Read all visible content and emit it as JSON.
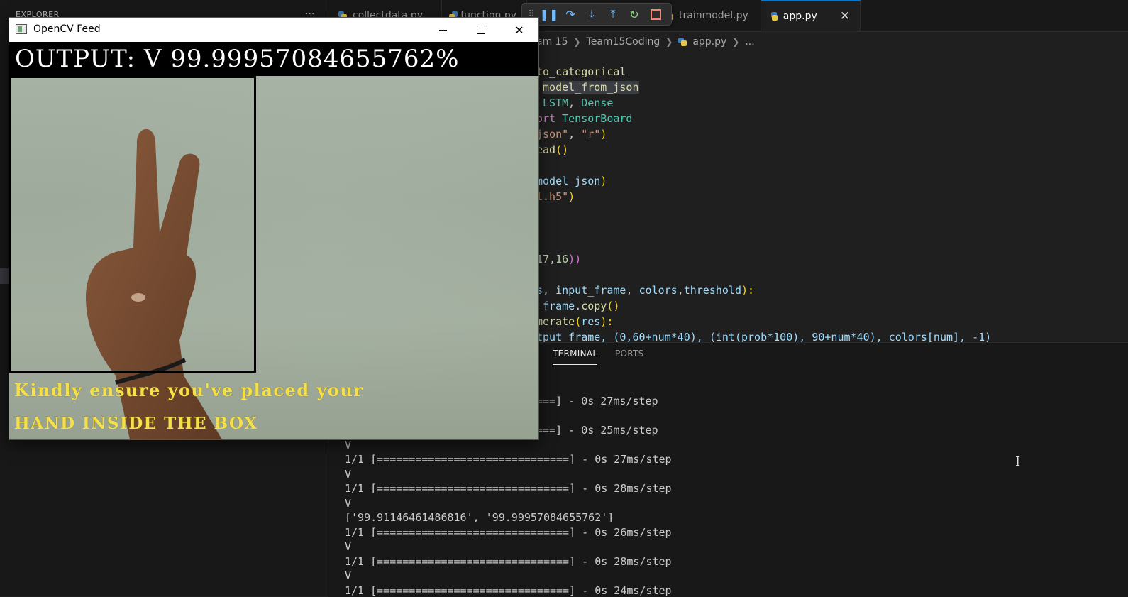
{
  "sidebar": {
    "title": "EXPLORER",
    "more_label": "···"
  },
  "tabs": [
    {
      "label": "collectdata.py",
      "active": false
    },
    {
      "label": "function.py",
      "active": false
    },
    {
      "label": "trainmodel.py",
      "active": false
    },
    {
      "label": "app.py",
      "active": true,
      "close": "✕"
    }
  ],
  "debug_toolbar": [
    "drag-handle",
    "pause",
    "step-over",
    "step-into",
    "step-out",
    "restart",
    "stop"
  ],
  "breadcrumb": {
    "items": [
      "am 15",
      "Team15Coding",
      "app.py",
      "..."
    ]
  },
  "editor": {
    "lines": [
      [
        {
          "t": "to_categorical",
          "c": "fn"
        }
      ],
      [
        {
          "t": " ",
          "c": "plain"
        },
        {
          "t": "model_from_json",
          "c": "fn",
          "hl": true
        }
      ],
      [
        {
          "t": " ",
          "c": "plain"
        },
        {
          "t": "LSTM",
          "c": "cls"
        },
        {
          "t": ", ",
          "c": "plain"
        },
        {
          "t": "Dense",
          "c": "cls"
        }
      ],
      [
        {
          "t": "ort ",
          "c": "kw"
        },
        {
          "t": "TensorBoard",
          "c": "cls"
        }
      ],
      [
        {
          "t": "json\"",
          "c": "str"
        },
        {
          "t": ", ",
          "c": "plain"
        },
        {
          "t": "\"r\"",
          "c": "str"
        },
        {
          "t": ")",
          "c": "br1"
        }
      ],
      [
        {
          "t": "ead",
          "c": "fn"
        },
        {
          "t": "()",
          "c": "br1"
        }
      ],
      [],
      [
        {
          "t": "model_json",
          "c": "var"
        },
        {
          "t": ")",
          "c": "br1"
        }
      ],
      [
        {
          "t": "l.h5\"",
          "c": "str"
        },
        {
          "t": ")",
          "c": "br1"
        }
      ],
      [],
      [],
      [],
      [
        {
          "t": "17",
          "c": "num"
        },
        {
          "t": ",",
          "c": "plain"
        },
        {
          "t": "16",
          "c": "num"
        },
        {
          "t": "))",
          "c": "br2"
        }
      ],
      [],
      [
        {
          "t": "s",
          "c": "var"
        },
        {
          "t": ", ",
          "c": "plain"
        },
        {
          "t": "input_frame",
          "c": "var"
        },
        {
          "t": ", ",
          "c": "plain"
        },
        {
          "t": "colors",
          "c": "var"
        },
        {
          "t": ",",
          "c": "plain"
        },
        {
          "t": "threshold",
          "c": "var"
        },
        {
          "t": "):",
          "c": "br1"
        }
      ],
      [
        {
          "t": "_frame",
          "c": "var"
        },
        {
          "t": ".",
          "c": "plain"
        },
        {
          "t": "copy",
          "c": "fn"
        },
        {
          "t": "()",
          "c": "br1"
        }
      ],
      [
        {
          "t": "merate",
          "c": "fn"
        },
        {
          "t": "(",
          "c": "br1"
        },
        {
          "t": "res",
          "c": "var"
        },
        {
          "t": "):",
          "c": "br1"
        }
      ],
      [
        {
          "t": "tput_frame, (0,60+num*40), (int(prob*100), 90+num*40), colors[num], -1)",
          "c": "var"
        }
      ]
    ]
  },
  "panel": {
    "tabs": [
      {
        "label": "TERMINAL",
        "active": true
      },
      {
        "label": "PORTS",
        "active": false
      }
    ]
  },
  "terminal": {
    "lines": [
      "===] - 0s 27ms/step",
      "",
      "===] - 0s 25ms/step",
      "V",
      "1/1 [==============================] - 0s 27ms/step",
      "V",
      "1/1 [==============================] - 0s 28ms/step",
      "V",
      "['99.91146461486816', '99.99957084655762']",
      "1/1 [==============================] - 0s 26ms/step",
      "V",
      "1/1 [==============================] - 0s 28ms/step",
      "V",
      "1/1 [==============================] - 0s 24ms/step"
    ]
  },
  "opencv": {
    "window_title": "OpenCV Feed",
    "output_text": "OUTPUT: V 99.99957084655762%",
    "warning_line_1": "Kindly ensure you've placed your",
    "warning_line_2": "HAND INSIDE THE BOX",
    "close_glyph": "✕"
  },
  "colors": {
    "accent": "#0078d4",
    "warning_text": "#f5e04a",
    "editor_bg": "#1f1f1f"
  }
}
